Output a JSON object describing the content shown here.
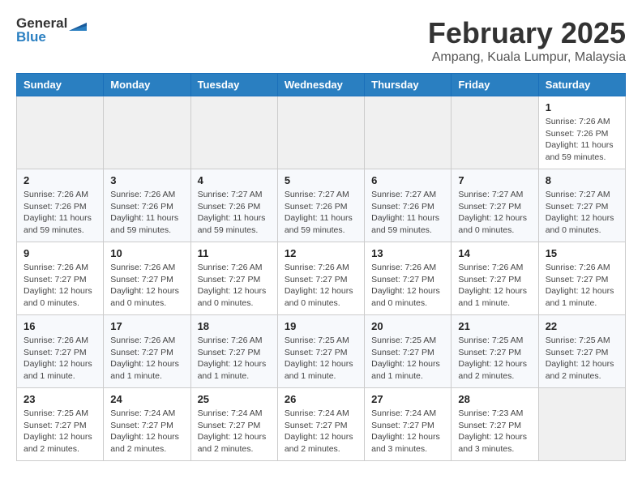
{
  "header": {
    "logo_general": "General",
    "logo_blue": "Blue",
    "month_title": "February 2025",
    "location": "Ampang, Kuala Lumpur, Malaysia"
  },
  "weekdays": [
    "Sunday",
    "Monday",
    "Tuesday",
    "Wednesday",
    "Thursday",
    "Friday",
    "Saturday"
  ],
  "weeks": [
    [
      {
        "day": "",
        "info": ""
      },
      {
        "day": "",
        "info": ""
      },
      {
        "day": "",
        "info": ""
      },
      {
        "day": "",
        "info": ""
      },
      {
        "day": "",
        "info": ""
      },
      {
        "day": "",
        "info": ""
      },
      {
        "day": "1",
        "info": "Sunrise: 7:26 AM\nSunset: 7:26 PM\nDaylight: 11 hours and 59 minutes."
      }
    ],
    [
      {
        "day": "2",
        "info": "Sunrise: 7:26 AM\nSunset: 7:26 PM\nDaylight: 11 hours and 59 minutes."
      },
      {
        "day": "3",
        "info": "Sunrise: 7:26 AM\nSunset: 7:26 PM\nDaylight: 11 hours and 59 minutes."
      },
      {
        "day": "4",
        "info": "Sunrise: 7:27 AM\nSunset: 7:26 PM\nDaylight: 11 hours and 59 minutes."
      },
      {
        "day": "5",
        "info": "Sunrise: 7:27 AM\nSunset: 7:26 PM\nDaylight: 11 hours and 59 minutes."
      },
      {
        "day": "6",
        "info": "Sunrise: 7:27 AM\nSunset: 7:26 PM\nDaylight: 11 hours and 59 minutes."
      },
      {
        "day": "7",
        "info": "Sunrise: 7:27 AM\nSunset: 7:27 PM\nDaylight: 12 hours and 0 minutes."
      },
      {
        "day": "8",
        "info": "Sunrise: 7:27 AM\nSunset: 7:27 PM\nDaylight: 12 hours and 0 minutes."
      }
    ],
    [
      {
        "day": "9",
        "info": "Sunrise: 7:26 AM\nSunset: 7:27 PM\nDaylight: 12 hours and 0 minutes."
      },
      {
        "day": "10",
        "info": "Sunrise: 7:26 AM\nSunset: 7:27 PM\nDaylight: 12 hours and 0 minutes."
      },
      {
        "day": "11",
        "info": "Sunrise: 7:26 AM\nSunset: 7:27 PM\nDaylight: 12 hours and 0 minutes."
      },
      {
        "day": "12",
        "info": "Sunrise: 7:26 AM\nSunset: 7:27 PM\nDaylight: 12 hours and 0 minutes."
      },
      {
        "day": "13",
        "info": "Sunrise: 7:26 AM\nSunset: 7:27 PM\nDaylight: 12 hours and 0 minutes."
      },
      {
        "day": "14",
        "info": "Sunrise: 7:26 AM\nSunset: 7:27 PM\nDaylight: 12 hours and 1 minute."
      },
      {
        "day": "15",
        "info": "Sunrise: 7:26 AM\nSunset: 7:27 PM\nDaylight: 12 hours and 1 minute."
      }
    ],
    [
      {
        "day": "16",
        "info": "Sunrise: 7:26 AM\nSunset: 7:27 PM\nDaylight: 12 hours and 1 minute."
      },
      {
        "day": "17",
        "info": "Sunrise: 7:26 AM\nSunset: 7:27 PM\nDaylight: 12 hours and 1 minute."
      },
      {
        "day": "18",
        "info": "Sunrise: 7:26 AM\nSunset: 7:27 PM\nDaylight: 12 hours and 1 minute."
      },
      {
        "day": "19",
        "info": "Sunrise: 7:25 AM\nSunset: 7:27 PM\nDaylight: 12 hours and 1 minute."
      },
      {
        "day": "20",
        "info": "Sunrise: 7:25 AM\nSunset: 7:27 PM\nDaylight: 12 hours and 1 minute."
      },
      {
        "day": "21",
        "info": "Sunrise: 7:25 AM\nSunset: 7:27 PM\nDaylight: 12 hours and 2 minutes."
      },
      {
        "day": "22",
        "info": "Sunrise: 7:25 AM\nSunset: 7:27 PM\nDaylight: 12 hours and 2 minutes."
      }
    ],
    [
      {
        "day": "23",
        "info": "Sunrise: 7:25 AM\nSunset: 7:27 PM\nDaylight: 12 hours and 2 minutes."
      },
      {
        "day": "24",
        "info": "Sunrise: 7:24 AM\nSunset: 7:27 PM\nDaylight: 12 hours and 2 minutes."
      },
      {
        "day": "25",
        "info": "Sunrise: 7:24 AM\nSunset: 7:27 PM\nDaylight: 12 hours and 2 minutes."
      },
      {
        "day": "26",
        "info": "Sunrise: 7:24 AM\nSunset: 7:27 PM\nDaylight: 12 hours and 2 minutes."
      },
      {
        "day": "27",
        "info": "Sunrise: 7:24 AM\nSunset: 7:27 PM\nDaylight: 12 hours and 3 minutes."
      },
      {
        "day": "28",
        "info": "Sunrise: 7:23 AM\nSunset: 7:27 PM\nDaylight: 12 hours and 3 minutes."
      },
      {
        "day": "",
        "info": ""
      }
    ]
  ]
}
